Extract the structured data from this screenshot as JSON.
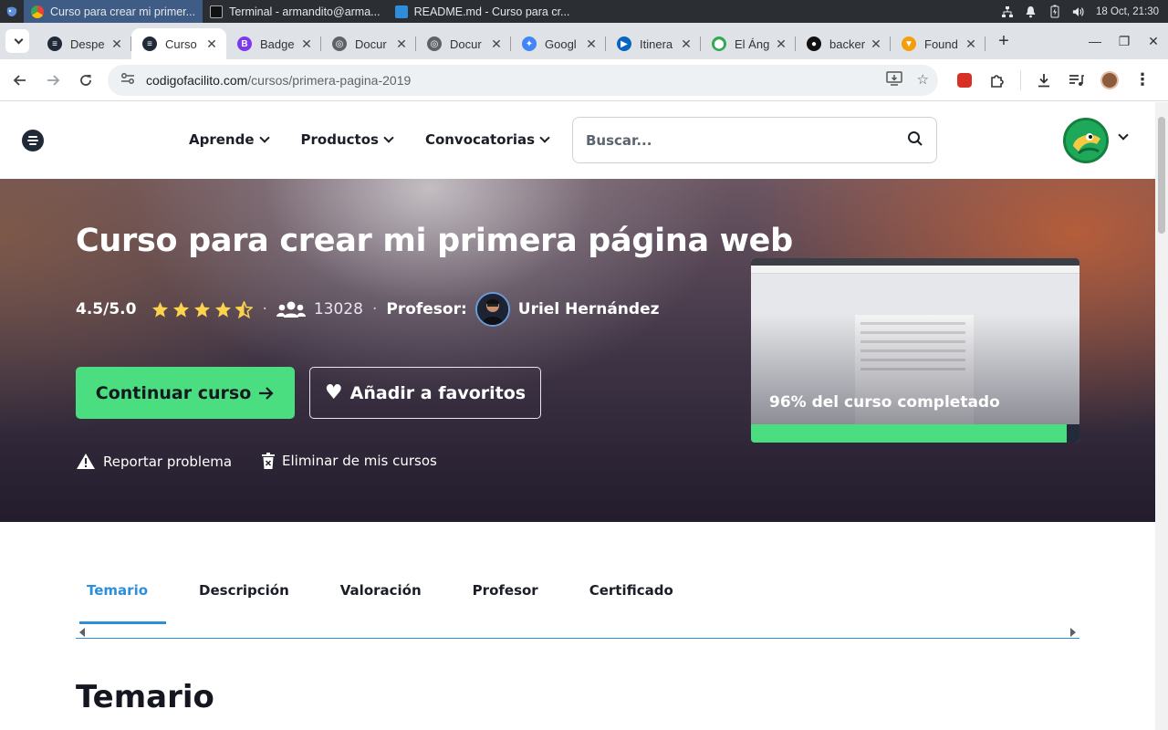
{
  "os": {
    "tasks": [
      {
        "label": "Curso para crear mi primer...",
        "icon": "chrome-icon",
        "active": true
      },
      {
        "label": "Terminal - armandito@arma...",
        "icon": "terminal-icon",
        "active": false
      },
      {
        "label": "README.md - Curso para cr...",
        "icon": "vscode-icon",
        "active": false
      }
    ],
    "clock": "18 Oct, 21:30"
  },
  "browser": {
    "tabs": [
      {
        "label": "Despe",
        "favicon_color": "#1f2937",
        "favicon_glyph": "≡"
      },
      {
        "label": "Curso",
        "favicon_color": "#1f2937",
        "favicon_glyph": "≡",
        "active": true
      },
      {
        "label": "Badge",
        "favicon_color": "#7c3aed",
        "favicon_glyph": "B"
      },
      {
        "label": "Docur",
        "favicon_color": "#5f6368",
        "favicon_glyph": "◎"
      },
      {
        "label": "Docur",
        "favicon_color": "#5f6368",
        "favicon_glyph": "◎"
      },
      {
        "label": "Googl",
        "favicon_color": "#4285f4",
        "favicon_glyph": "✦"
      },
      {
        "label": "Itinera",
        "favicon_color": "#0b64c0",
        "favicon_glyph": "▶"
      },
      {
        "label": "El Áng",
        "favicon_color": "#34a853",
        "favicon_glyph": "⬤"
      },
      {
        "label": "backer",
        "favicon_color": "#111111",
        "favicon_glyph": "●"
      },
      {
        "label": "Found",
        "favicon_color": "#f59e0b",
        "favicon_glyph": "▼"
      }
    ],
    "url_host": "codigofacilito.com",
    "url_path": "/cursos/primera-pagina-2019"
  },
  "header": {
    "menu": [
      "Aprende",
      "Productos",
      "Convocatorias"
    ],
    "search_placeholder": "Buscar..."
  },
  "hero": {
    "title": "Curso para crear mi primera página web",
    "rating": "4.5/5.0",
    "stars": 4.5,
    "students": "13028",
    "professor_label": "Profesor:",
    "professor_name": "Uriel Hernández",
    "continue_label": "Continuar curso",
    "favorite_label": "Añadir a favoritos",
    "report_label": "Reportar problema",
    "remove_label": "Eliminar de mis cursos",
    "progress_text": "96% del curso completado",
    "progress": 0.96
  },
  "course_tabs": [
    "Temario",
    "Descripción",
    "Valoración",
    "Profesor",
    "Certificado"
  ],
  "section": {
    "title": "Temario"
  },
  "colors": {
    "accent_green": "#4ade80",
    "accent_blue": "#2b8fd9",
    "star": "#fcd34d"
  }
}
